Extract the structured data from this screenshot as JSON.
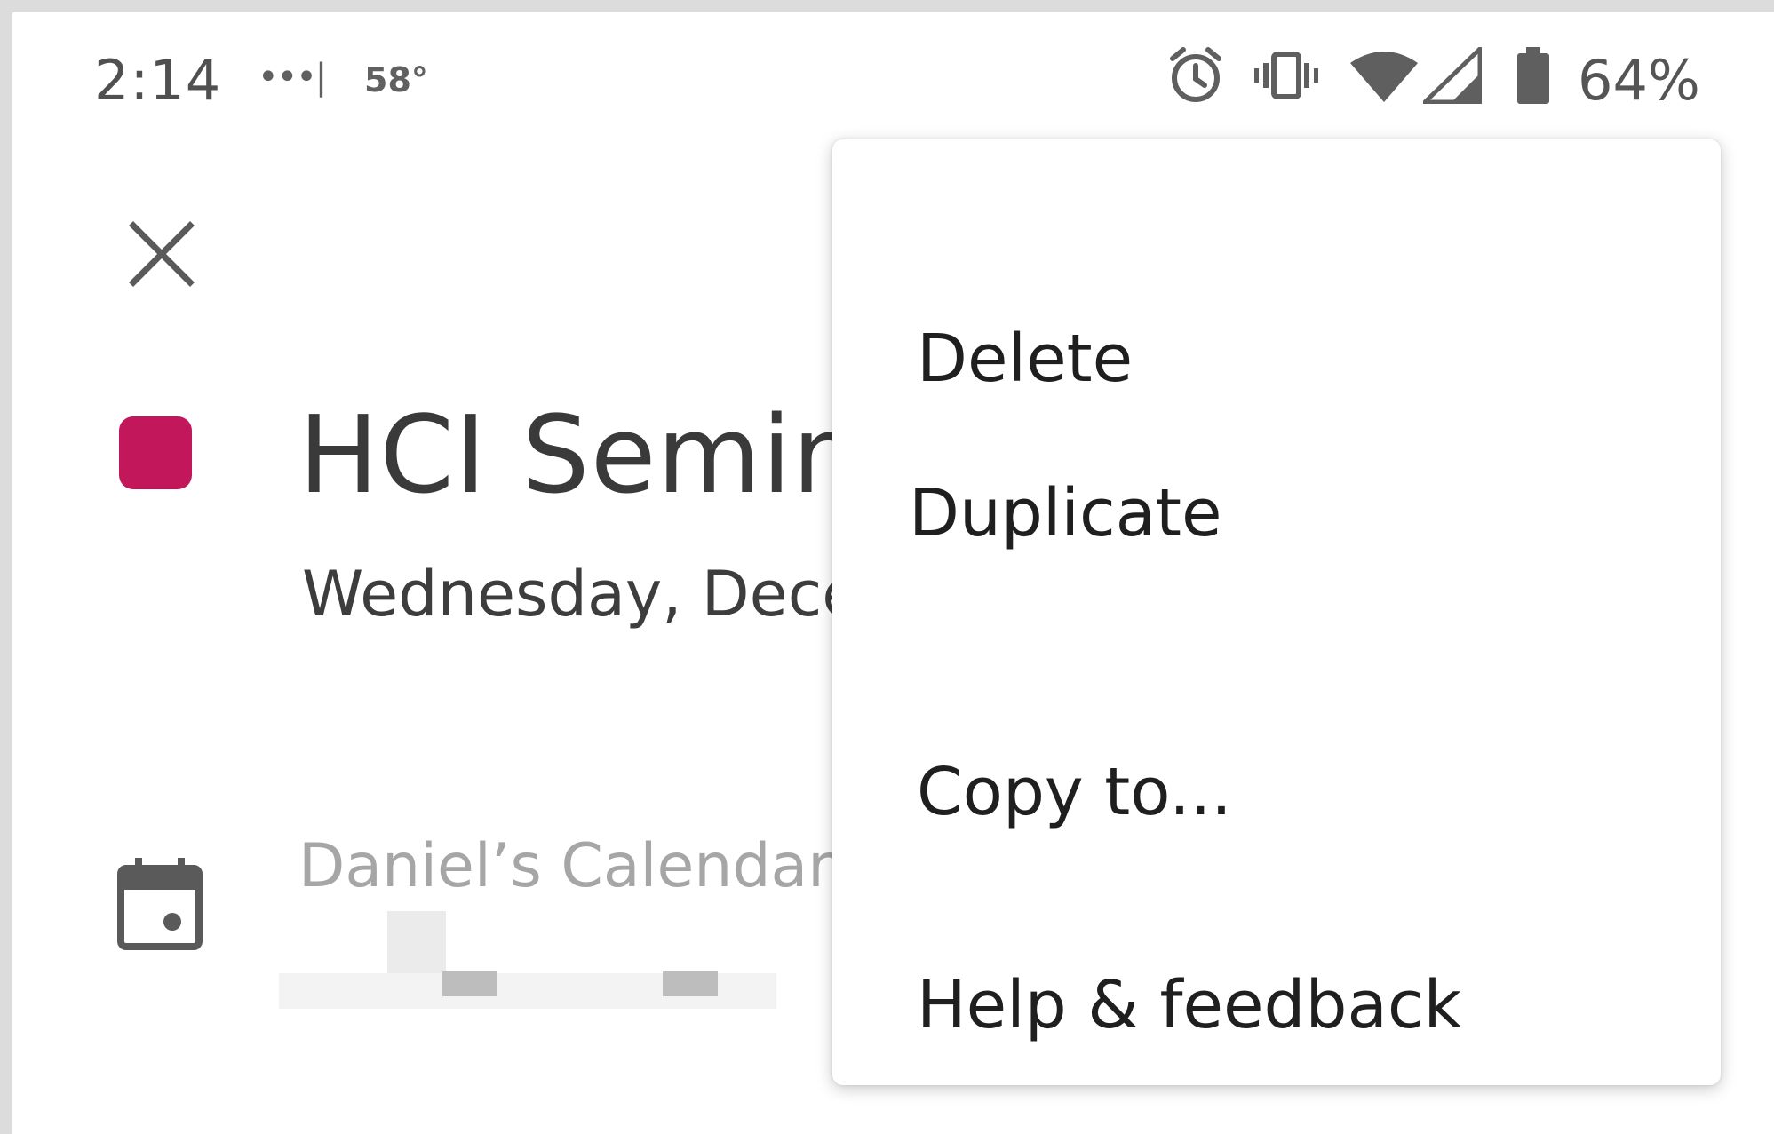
{
  "status_bar": {
    "time": "2:14",
    "signal_dots": "•••|",
    "temperature": "58°",
    "battery": "64%",
    "icons": [
      "alarm-icon",
      "vibrate-icon",
      "wifi-icon",
      "cell-signal-icon",
      "battery-icon"
    ]
  },
  "toolbar": {
    "close_icon": "close-icon"
  },
  "event": {
    "color": "#c2185b",
    "title": "HCI Seminar",
    "date": "Wednesday, December",
    "calendar_name": "Daniel’s Calendar"
  },
  "menu": {
    "items": [
      {
        "label": "Delete"
      },
      {
        "label": "Duplicate"
      },
      {
        "label": "Copy to..."
      },
      {
        "label": "Help & feedback"
      }
    ]
  }
}
